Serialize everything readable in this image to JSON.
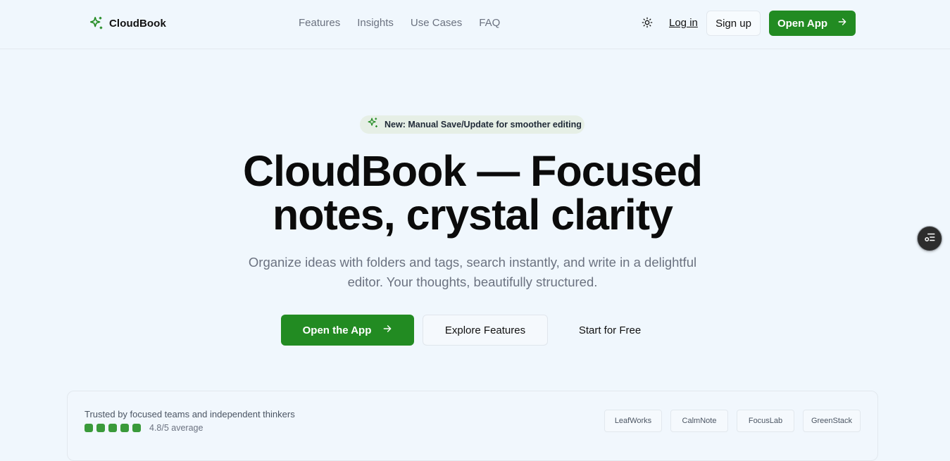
{
  "brand": {
    "name": "CloudBook",
    "accent": "#228b22",
    "icon": "sparkles-icon"
  },
  "nav": {
    "items": [
      "Features",
      "Insights",
      "Use Cases",
      "FAQ"
    ]
  },
  "header": {
    "theme_icon": "sun-icon",
    "login_label": "Log in",
    "signup_label": "Sign up",
    "open_app_label": "Open App"
  },
  "badge": {
    "text": "New: Manual Save/Update for smoother editing",
    "icon": "sparkles-icon"
  },
  "hero": {
    "title_line1": "CloudBook — Focused",
    "title_line2": "notes, crystal clarity",
    "subtitle_line1": "Organize ideas with folders and tags, search instantly, and write in a delightful",
    "subtitle_line2": "editor. Your thoughts, beautifully structured.",
    "cta_primary": "Open the App",
    "cta_secondary": "Explore Features",
    "cta_tertiary": "Start for Free"
  },
  "floating": {
    "icon": "list-settings-icon"
  },
  "trust": {
    "text": "Trusted by focused teams and independent thinkers",
    "rating_text": "4.8/5 average",
    "rating_dots": 5,
    "logos": [
      "LeafWorks",
      "CalmNote",
      "FocusLab",
      "GreenStack"
    ]
  }
}
